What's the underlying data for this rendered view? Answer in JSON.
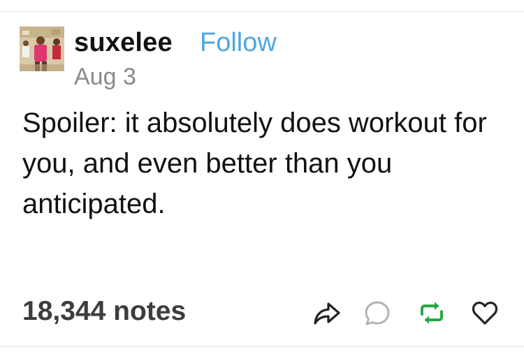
{
  "post": {
    "author": "suxelee",
    "follow_label": "Follow",
    "date": "Aug 3",
    "body": "Spoiler: it absolutely does workout for you, and even better than you anticipated."
  },
  "footer": {
    "notes": "18,344 notes",
    "actions": [
      {
        "icon": "share-icon"
      },
      {
        "icon": "reply-icon"
      },
      {
        "icon": "reblog-icon"
      },
      {
        "icon": "like-icon"
      }
    ]
  },
  "colors": {
    "follow": "#4ea6e0",
    "reblog": "#28a745",
    "secondary_text": "#8a8a8a"
  }
}
